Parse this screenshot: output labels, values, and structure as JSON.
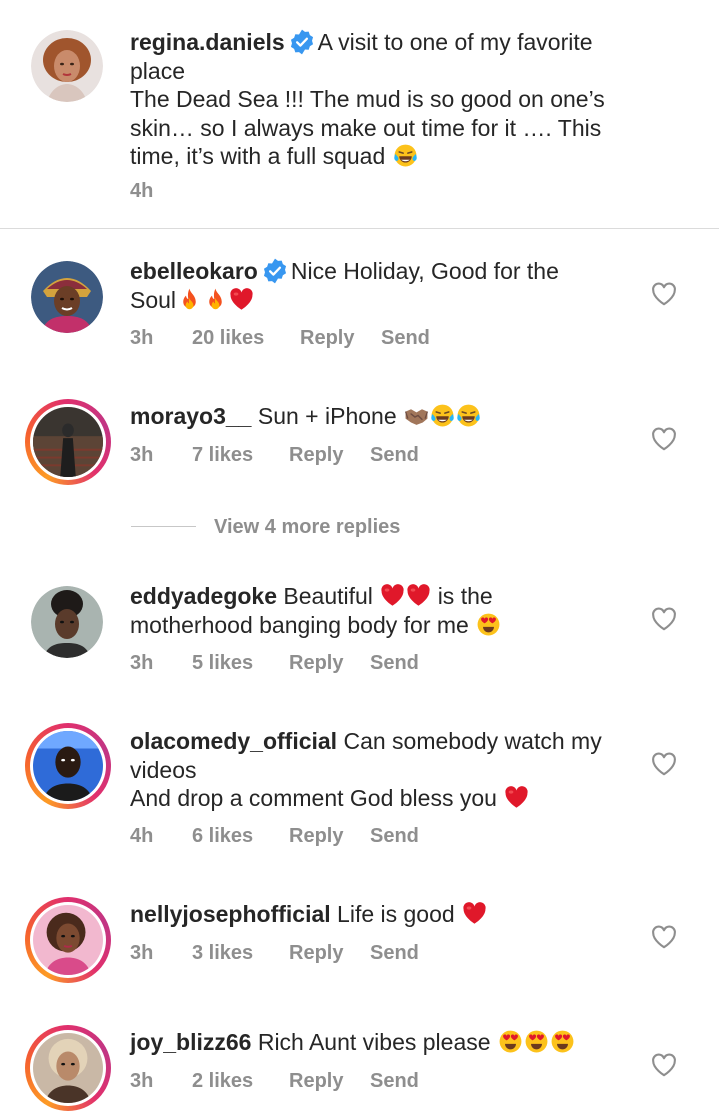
{
  "caption": {
    "username": "regina.daniels",
    "lines": [
      "A visit to one of my favorite",
      "place",
      "The Dead Sea !!! The mud is so good on one’s",
      "skin… so I always make out time for it …. This",
      "time, it’s with a full squad"
    ],
    "time": "4h",
    "emoji": [
      "tears-of-joy"
    ]
  },
  "comments": [
    {
      "username": "ebelleokaro",
      "verified": true,
      "text_line1": "Nice Holiday, Good for the",
      "text_line2": "Soul",
      "emoji": [
        "fire",
        "fire",
        "red-heart"
      ],
      "time": "3h",
      "likes": "20 likes",
      "reply": "Reply",
      "send": "Send"
    },
    {
      "username": "morayo3__",
      "text_line1": "Sun + iPhone",
      "emoji": [
        "handshake",
        "tears-of-joy",
        "tears-of-joy"
      ],
      "time": "3h",
      "likes": "7 likes",
      "reply": "Reply",
      "send": "Send"
    },
    {
      "username": "eddyadegoke",
      "text_line1a": "Beautiful",
      "text_line1b": "is the",
      "text_line2": "motherhood banging body for me",
      "emoji": [
        "red-heart",
        "red-heart",
        "heart-eyes"
      ],
      "time": "3h",
      "likes": "5 likes",
      "reply": "Reply",
      "send": "Send"
    },
    {
      "username": "olacomedy_official",
      "text_line1": "Can somebody watch my",
      "text_line2": "videos",
      "text_line3": "And drop a comment  God bless you",
      "emoji": [
        "red-heart"
      ],
      "time": "4h",
      "likes": "6 likes",
      "reply": "Reply",
      "send": "Send"
    },
    {
      "username": "nellyjosephofficial",
      "text_line1": "Life is good",
      "emoji": [
        "red-heart"
      ],
      "time": "3h",
      "likes": "3 likes",
      "reply": "Reply",
      "send": "Send"
    },
    {
      "username": "joy_blizz66",
      "text_line1": "Rich Aunt vibes please",
      "emoji": [
        "heart-eyes",
        "heart-eyes",
        "heart-eyes"
      ],
      "time": "3h",
      "likes": "2 likes",
      "reply": "Reply",
      "send": "Send"
    }
  ],
  "view_more_replies": "View 4 more replies",
  "colors": {
    "text": "#262626",
    "muted": "#8e8e8e",
    "verified_blue": "#3897f0",
    "story_ring": "#e1306c",
    "divider": "#dbdbdb"
  }
}
